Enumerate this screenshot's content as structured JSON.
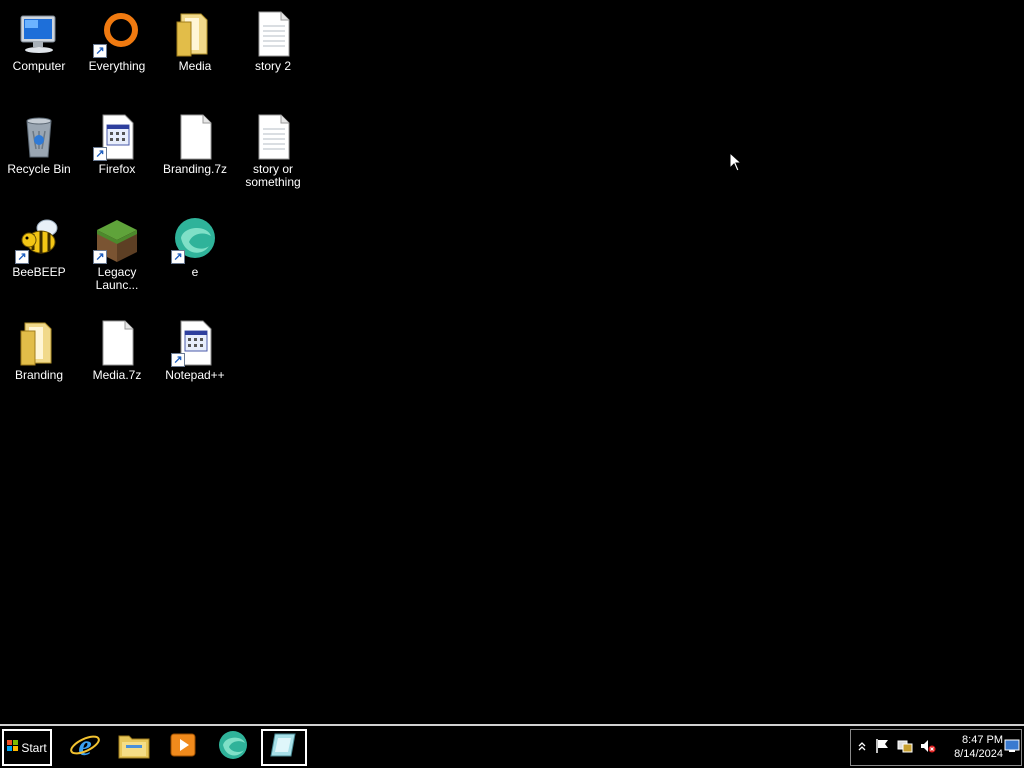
{
  "desktop": {
    "icons": {
      "computer": "Computer",
      "everything": "Everything",
      "media": "Media",
      "story2": "story 2",
      "recycle_bin": "Recycle Bin",
      "firefox": "Firefox",
      "branding_7z": "Branding.7z",
      "story_or_something": "story or something",
      "beebeep": "BeeBEEP",
      "legacy_launcher": "Legacy Launc...",
      "e": "e",
      "branding": "Branding",
      "media_7z": "Media.7z",
      "notepadpp": "Notepad++"
    }
  },
  "taskbar": {
    "start_label": "Start",
    "pinned": [
      "internet-explorer-icon",
      "file-explorer-icon",
      "media-player-icon",
      "edge-icon",
      "notepad-icon"
    ],
    "clock_time": "8:47 PM",
    "clock_date": "8/14/2024",
    "tray": [
      "show-hidden-icon",
      "action-center-flag-icon",
      "network-icon",
      "volume-muted-icon",
      "show-desktop-icon"
    ]
  },
  "colors": {
    "background": "#000000",
    "folder": "#e8c75a",
    "everything_orange": "#f07a10",
    "edge_teal": "#2fb39a"
  }
}
